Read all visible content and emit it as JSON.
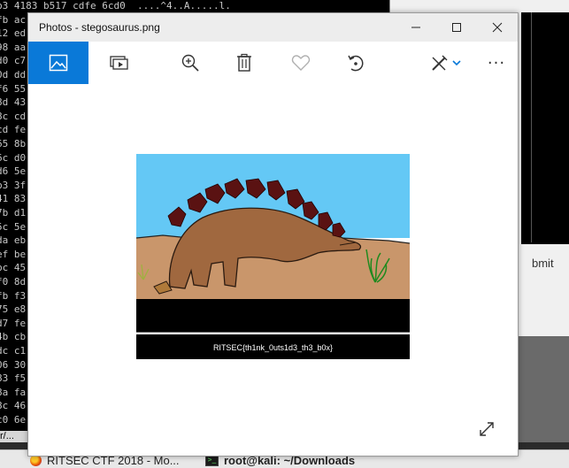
{
  "terminal": {
    "rows": [
      "b3 4183 b517 cdfe 6cd0  ....^4..A.....l.",
      "fb ac",
      "12 ed",
      "98 aa",
      "d0 c7",
      "0d dd",
      "f6 55",
      "8d 43",
      "8c cd",
      "cd fe",
      "65 8b",
      "6c d0",
      "d6 5e",
      "b3 3f",
      "41 83",
      "7b d1",
      "5c 5e",
      "da eb",
      "ef be",
      "bc 45",
      "f0 8d",
      "fb f3",
      "75 e8",
      "d7 fe",
      "4b cb",
      "dc c1",
      "06 30",
      "83 f5",
      "8a fa",
      "8c 46",
      "c0 6e"
    ],
    "bottom_text": "r/..."
  },
  "right_window": {
    "submit_label": "bmit"
  },
  "taskbar": {
    "items": [
      {
        "label": "RITSEC CTF 2018 - Mo...",
        "icon": "firefox-icon"
      },
      {
        "label": "root@kali: ~/Downloads",
        "icon": "terminal-icon"
      }
    ]
  },
  "photos": {
    "title": "Photos - stegosaurus.png",
    "toolbar": [
      {
        "name": "view-image-icon",
        "active": true
      },
      {
        "name": "slideshow-icon"
      },
      {
        "name": "zoom-icon"
      },
      {
        "name": "delete-icon"
      },
      {
        "name": "favorite-heart-icon"
      },
      {
        "name": "rotate-icon"
      },
      {
        "name": "edit-draw-icon"
      },
      {
        "name": "more-options-icon",
        "label": "···"
      }
    ],
    "image_caption": "RITSEC{th1nk_0uts1d3_th3_b0x}",
    "colors": {
      "accent": "#0a79d8",
      "sky": "#64c8f5",
      "ground": "#c9966b",
      "dino": "#a0683f",
      "plates": "#5a1212"
    }
  }
}
